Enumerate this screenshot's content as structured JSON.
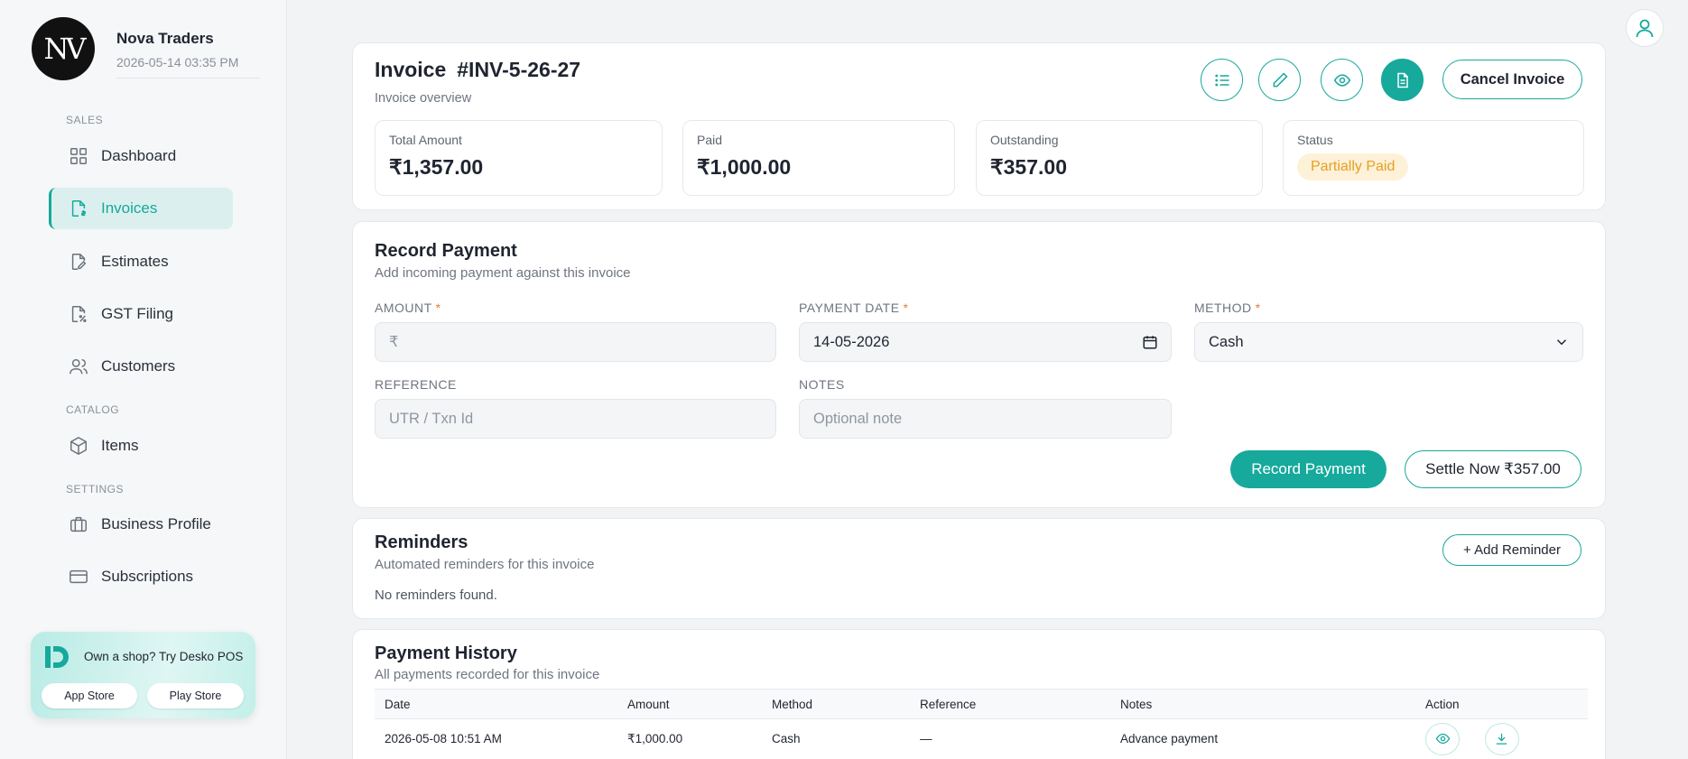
{
  "sidebar": {
    "logo": "NV",
    "business_name": "Nova Traders",
    "datetime": "2026-05-14 03:35 PM",
    "sections": {
      "sales": "SALES",
      "catalog": "CATALOG",
      "settings": "SETTINGS"
    },
    "items": [
      {
        "label": "Dashboard",
        "icon": "grid-icon"
      },
      {
        "label": "Invoices",
        "icon": "invoice-icon",
        "active": true
      },
      {
        "label": "Estimates",
        "icon": "estimate-icon"
      },
      {
        "label": "GST Filing",
        "icon": "gst-icon"
      },
      {
        "label": "Customers",
        "icon": "users-icon"
      },
      {
        "label": "Items",
        "icon": "box-icon"
      },
      {
        "label": "Business Profile",
        "icon": "briefcase-icon"
      },
      {
        "label": "Subscriptions",
        "icon": "card-icon"
      }
    ],
    "promo": {
      "text": "Own a shop? Try Desko POS",
      "app_store": "App Store",
      "play_store": "Play Store"
    }
  },
  "invoice": {
    "title": "Invoice",
    "number": "#INV-5-26-27",
    "subtitle": "Invoice overview",
    "cancel_label": "Cancel Invoice",
    "stats": {
      "total_label": "Total Amount",
      "total_value": "₹1,357.00",
      "paid_label": "Paid",
      "paid_value": "₹1,000.00",
      "outstanding_label": "Outstanding",
      "outstanding_value": "₹357.00",
      "status_label": "Status",
      "status_value": "Partially Paid"
    }
  },
  "payment": {
    "title": "Record Payment",
    "subtitle": "Add incoming payment against this invoice",
    "amount_label": "AMOUNT",
    "amount_placeholder": "₹",
    "date_label": "PAYMENT DATE",
    "date_value": "14-05-2026",
    "method_label": "METHOD",
    "method_value": "Cash",
    "reference_label": "REFERENCE",
    "reference_placeholder": "UTR / Txn Id",
    "notes_label": "NOTES",
    "notes_placeholder": "Optional note",
    "required_mark": "*",
    "record_label": "Record Payment",
    "settle_label": "Settle Now ₹357.00"
  },
  "reminders": {
    "title": "Reminders",
    "subtitle": "Automated reminders for this invoice",
    "empty": "No reminders found.",
    "add_label": "+ Add Reminder"
  },
  "history": {
    "title": "Payment History",
    "subtitle": "All payments recorded for this invoice",
    "columns": [
      "Date",
      "Amount",
      "Method",
      "Reference",
      "Notes",
      "Action"
    ],
    "rows": [
      {
        "date": "2026-05-08 10:51 AM",
        "amount": "₹1,000.00",
        "method": "Cash",
        "reference": "—",
        "notes": "Advance payment"
      }
    ]
  },
  "colors": {
    "accent": "#16a99c",
    "status_bg": "#fdf1d8",
    "status_text": "#e6a020"
  }
}
